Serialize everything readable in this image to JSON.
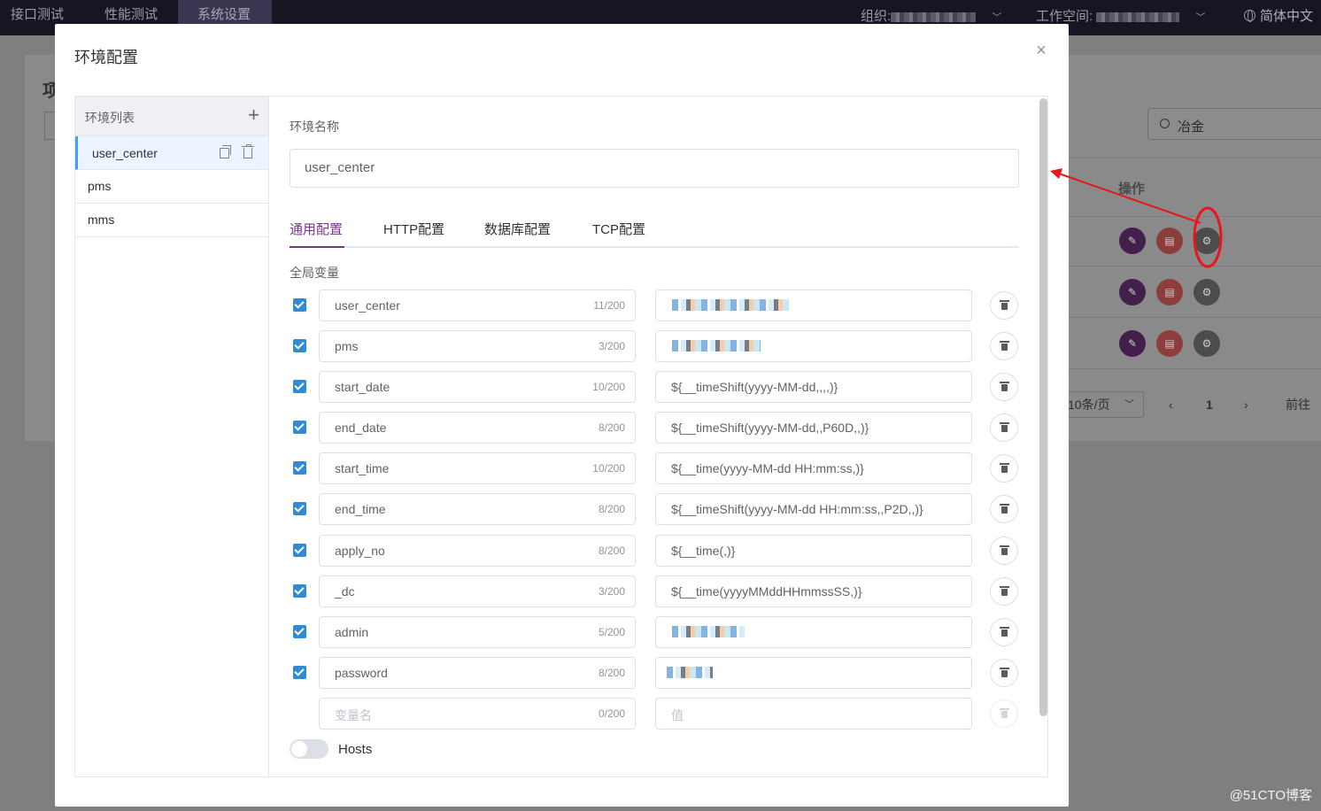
{
  "topnav": {
    "tabs": [
      {
        "label": "接口测试"
      },
      {
        "label": "性能测试"
      },
      {
        "label": "系统设置",
        "active": true
      }
    ],
    "org_label": "组织:",
    "workspace_label": "工作空间:",
    "language": "简体中文"
  },
  "background": {
    "title_fragment": "项",
    "search_value": "冶金",
    "column_header": "操作",
    "page_size": "10条/页",
    "current_page": "1",
    "goto_label": "前往"
  },
  "dialog": {
    "title": "环境配置",
    "env_list": {
      "header": "环境列表",
      "items": [
        {
          "name": "user_center",
          "active": true
        },
        {
          "name": "pms"
        },
        {
          "name": "mms"
        }
      ]
    },
    "env_name_label": "环境名称",
    "env_name_value": "user_center",
    "tabs": [
      "通用配置",
      "HTTP配置",
      "数据库配置",
      "TCP配置"
    ],
    "active_tab": "通用配置",
    "global_vars_label": "全局变量",
    "variables": [
      {
        "name": "user_center",
        "count": "11/200",
        "value": "",
        "value_obscured": true
      },
      {
        "name": "pms",
        "count": "3/200",
        "value": "",
        "value_obscured": true
      },
      {
        "name": "start_date",
        "count": "10/200",
        "value": "${__timeShift(yyyy-MM-dd,,,,)}"
      },
      {
        "name": "end_date",
        "count": "8/200",
        "value": "${__timeShift(yyyy-MM-dd,,P60D,,)}"
      },
      {
        "name": "start_time",
        "count": "10/200",
        "value": "${__time(yyyy-MM-dd HH:mm:ss,)}"
      },
      {
        "name": "end_time",
        "count": "8/200",
        "value": "${__timeShift(yyyy-MM-dd HH:mm:ss,,P2D,,)}"
      },
      {
        "name": "apply_no",
        "count": "8/200",
        "value": "${__time(,)}"
      },
      {
        "name": "_dc",
        "count": "3/200",
        "value": "${__time(yyyyMMddHHmmssSS,)}"
      },
      {
        "name": "admin",
        "count": "5/200",
        "value": "",
        "value_obscured": true
      },
      {
        "name": "password",
        "count": "8/200",
        "value": "",
        "value_obscured": true
      }
    ],
    "new_var": {
      "name_placeholder": "变量名",
      "count": "0/200",
      "value_placeholder": "值"
    },
    "hosts_label": "Hosts",
    "hosts_enabled": false
  },
  "watermark": "@51CTO博客",
  "colors": {
    "accent": "#783887",
    "checkbox": "#2f8bd8",
    "active_border": "#409eff",
    "annotation": "#e8161b"
  }
}
